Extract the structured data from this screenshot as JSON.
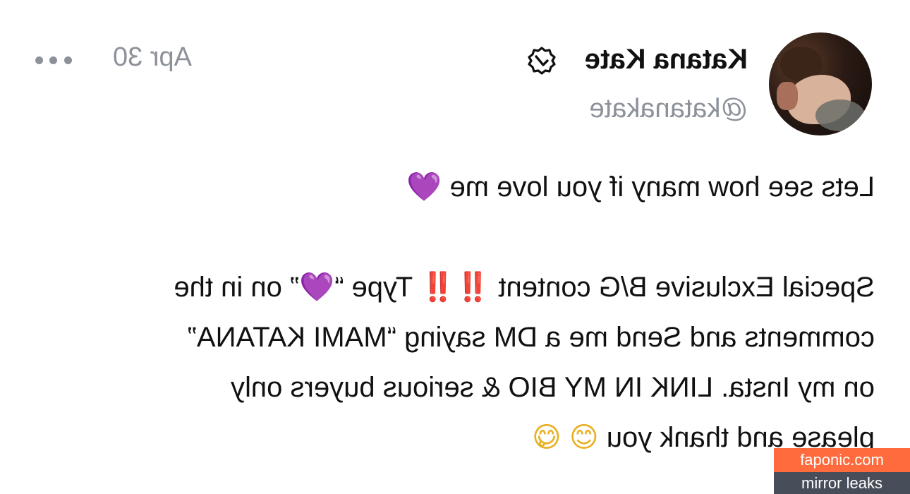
{
  "post": {
    "author": {
      "display_name": "Katana Kate",
      "handle": "@katanakate",
      "verified_badge_icon": "verified-badge-icon"
    },
    "date": "Apr 30",
    "more_icon": "more-dots-icon",
    "body": {
      "line1": "Lets see how many if you love me",
      "line1_emoji": "💜",
      "line2_a": "Special Exclusive B/G content ",
      "line2_emoji_bang": "‼️‼️",
      "line2_b": " Type “",
      "line2_emoji_heart": "💜",
      "line2_c": "” on in the",
      "line3": "comments and Send me a DM saying “MAMI KATANA”",
      "line4": "on my Insta. LINK IN MY BIO & serious buyers only",
      "line5": "please and thank you",
      "line5_emoji_1": "😊",
      "line5_emoji_2": "😋"
    }
  },
  "watermark": {
    "site": "faponic.com",
    "caption": "mirror leaks"
  },
  "colors": {
    "text": "#111111",
    "muted": "#8c919a",
    "heart": "#a159e6",
    "watermark_top": "#ff6b3d",
    "watermark_bottom": "#474e59"
  }
}
